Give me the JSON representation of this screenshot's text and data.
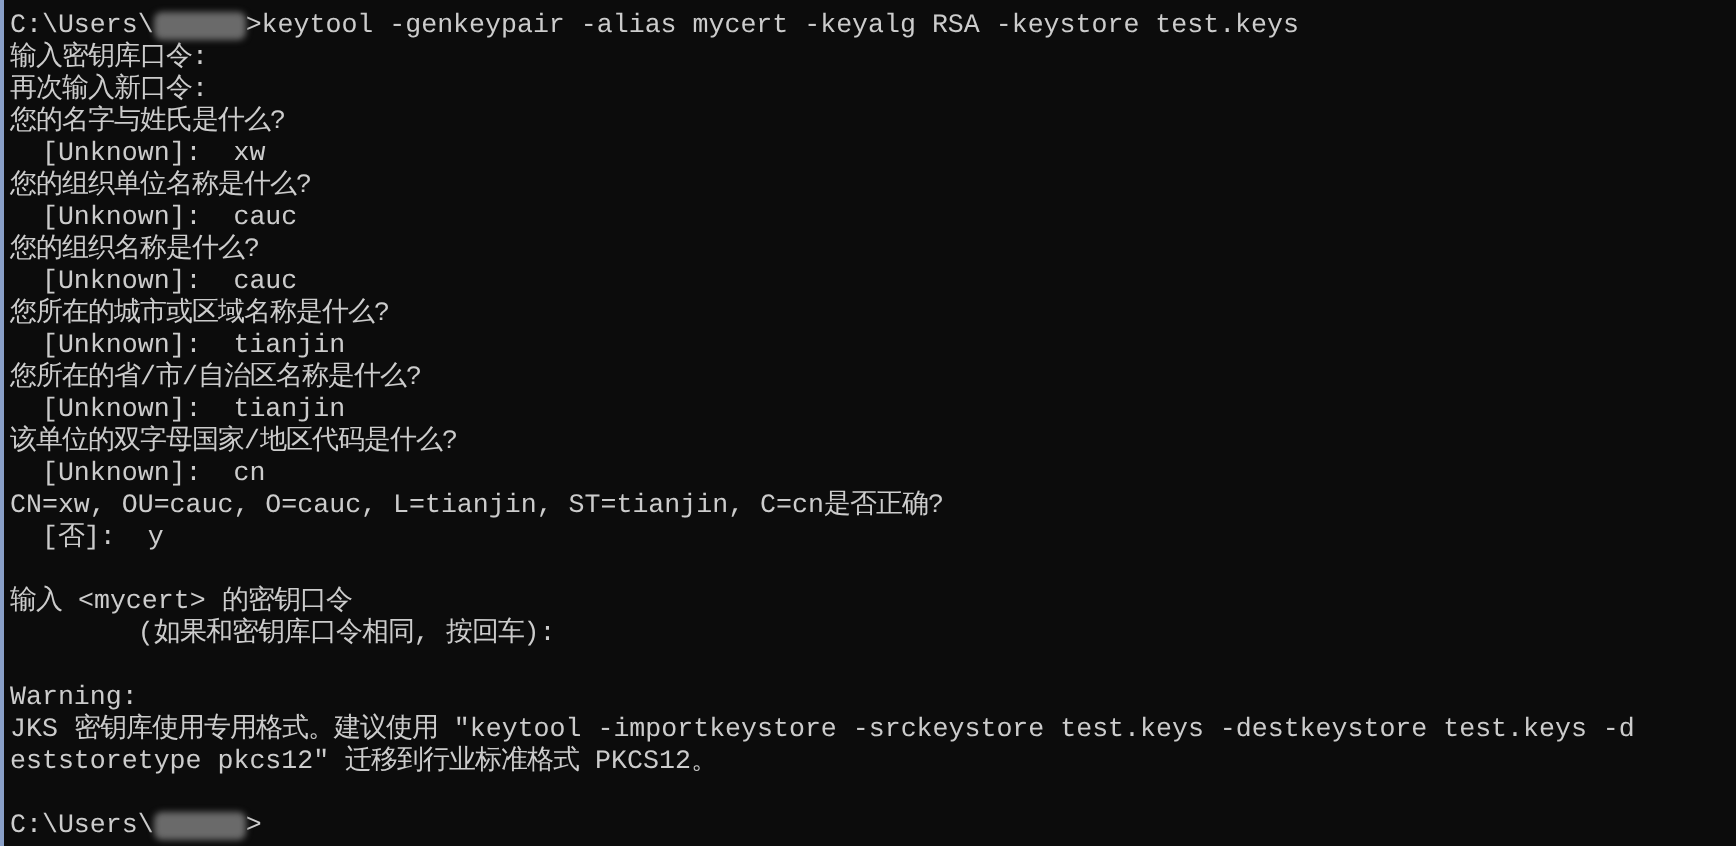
{
  "console": {
    "lines": [
      {
        "kind": "prompt",
        "path": "C:\\Users\\",
        "command": ">keytool -genkeypair -alias mycert -keyalg RSA -keystore test.keys"
      },
      {
        "kind": "text",
        "text": "输入密钥库口令:"
      },
      {
        "kind": "text",
        "text": "再次输入新口令:"
      },
      {
        "kind": "text",
        "text": "您的名字与姓氏是什么?"
      },
      {
        "kind": "text",
        "text": "  [Unknown]:  xw"
      },
      {
        "kind": "text",
        "text": "您的组织单位名称是什么?"
      },
      {
        "kind": "text",
        "text": "  [Unknown]:  cauc"
      },
      {
        "kind": "text",
        "text": "您的组织名称是什么?"
      },
      {
        "kind": "text",
        "text": "  [Unknown]:  cauc"
      },
      {
        "kind": "text",
        "text": "您所在的城市或区域名称是什么?"
      },
      {
        "kind": "text",
        "text": "  [Unknown]:  tianjin"
      },
      {
        "kind": "text",
        "text": "您所在的省/市/自治区名称是什么?"
      },
      {
        "kind": "text",
        "text": "  [Unknown]:  tianjin"
      },
      {
        "kind": "text",
        "text": "该单位的双字母国家/地区代码是什么?"
      },
      {
        "kind": "text",
        "text": "  [Unknown]:  cn"
      },
      {
        "kind": "text",
        "text": "CN=xw, OU=cauc, O=cauc, L=tianjin, ST=tianjin, C=cn是否正确?"
      },
      {
        "kind": "text",
        "text": "  [否]:  y"
      },
      {
        "kind": "blank"
      },
      {
        "kind": "text",
        "text": "输入 <mycert> 的密钥口令"
      },
      {
        "kind": "text",
        "text": "        (如果和密钥库口令相同, 按回车):"
      },
      {
        "kind": "blank"
      },
      {
        "kind": "text",
        "text": "Warning:"
      },
      {
        "kind": "text",
        "text": "JKS 密钥库使用专用格式。建议使用 \"keytool -importkeystore -srckeystore test.keys -destkeystore test.keys -d"
      },
      {
        "kind": "text",
        "text": "eststoretype pkcs12\" 迁移到行业标准格式 PKCS12。"
      },
      {
        "kind": "blank"
      },
      {
        "kind": "prompt",
        "path": "C:\\Users\\",
        "command": ">"
      }
    ]
  }
}
